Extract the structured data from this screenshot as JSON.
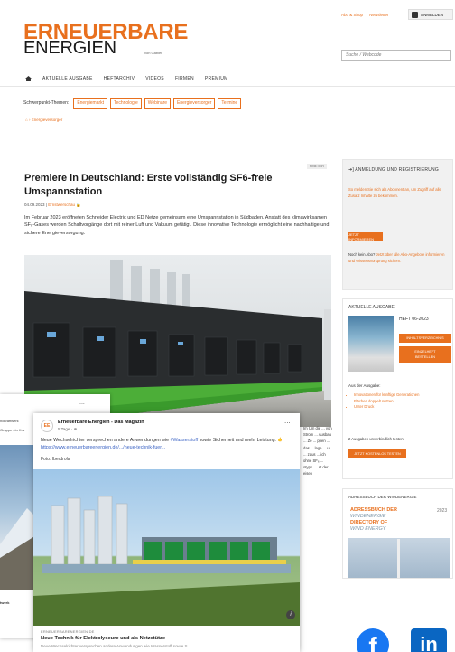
{
  "header": {
    "logo_top": "ERNEUERBARE",
    "logo_bottom": "ENERGIEN",
    "logo_tag": "von Gabler",
    "link_abo": "Abo & Shop",
    "link_newsletter": "Newsletter",
    "login_label": "ANMELDEN",
    "search_placeholder": "Suche / Webcode"
  },
  "nav": {
    "items": [
      "AKTUELLE AUSGABE",
      "HEFTARCHIV",
      "VIDEOS",
      "FIRMEN",
      "PREMIUM"
    ]
  },
  "topics": {
    "label": "Schwerpunkt-Themen:",
    "items": [
      "Energiemarkt",
      "Technologie",
      "Webinare",
      "Energieversorger",
      "Termine"
    ]
  },
  "breadcrumb": "Energieversorger",
  "article": {
    "category": "FINETIER",
    "title": "Premiere in Deutschland: Erste vollständig SF6-freie Umspannstation",
    "date": "04.09.2023",
    "source": "Ernstwerschau",
    "lead": "Im Februar 2023 eröffneten Schneider Electric und ED Netze gemeinsam eine Umspannstation in Südbaden. Anstatt des klimawirksamen SF₆-Gases werden Schaltvorgänge dort mit reiner Luft und Vakuum getätigt. Diese innovative Technologie ermöglicht eine nachhaltige und sichere Energieversorgung.",
    "photo_credit": "Schneider Electric",
    "right_text": "Im Um die ... von Strom ... Ausbau ... Ze ... ppen ... das ... lage ... ur ... zaus ... ich ohne SF₆ ... otyps. ... st der ... eisen"
  },
  "sidebar": {
    "login_title": "ANMELDUNG UND REGISTRIERUNG",
    "login_text": "So melden Sie sich als Abonnent an, um Zugriff auf alle Zusatz Inhalte zu bekommen.",
    "login_button": "JETZT INFORMIEREN",
    "no_abo_text_a": "Noch kein Abo?",
    "no_abo_text_b": "Jetzt über alle Abo-Angebote informieren und Wissensvorsprung sichern.",
    "issue_title": "AKTUELLE AUSGABE",
    "issue_name": "HEFT 06-2023",
    "btn_contents": "INHALTSVERZEICHNIS",
    "btn_order_1": "EINZELHEFT",
    "btn_order_2": "BESTELLEN",
    "from_issue": "Aus der Ausgabe:",
    "issue_items": [
      "Innovationen für künftige Generationen",
      "Flächen doppelt nutzen",
      "Unter Druck"
    ],
    "free_count": "2 Ausgaben unverbindlich testen:",
    "btn_trial": "JETZT KOSTENLOS TESTEN",
    "directory_title": "ADRESSBUCH DER WINDENERGIE",
    "directory_book_1": "ADRESSBUCH DER",
    "directory_book_2": "WINDENERGIE",
    "directory_book_3": "DIRECTORY OF",
    "directory_book_4": "WIND ENERGY",
    "directory_year": "2023"
  },
  "left_card": {
    "more": "...",
    "line1": "ndkraftwerk",
    "line2": "Gruppe ein Kra",
    "footer": "twerk"
  },
  "fb_embed": {
    "avatar": "EE",
    "page_name": "Erneuerbare Energien - Das Magazin",
    "time": "5 Tage · ",
    "more": "...",
    "text_a": "Neue Wechselrichter versprechen andere Anwendungen wie ",
    "hashtag": "#Wasserstoff",
    "text_b": " sowie Sicherheit und mehr Leistung: 👉 ",
    "link": "https://www.erneuerbareenergien.de/.../neue-technik-fuer...",
    "photo_credit": "Foto: Iberdrola",
    "caption_source": "ERNEUERBARENERGIEN.DE",
    "caption_title": "Neue Technik für Elektrolyseure und als Netzstütze",
    "caption_text": "Neue Wechselrichter versprechen andere Anwendungen wie Wasserstoff sowie S...",
    "info": "i"
  },
  "social": {
    "facebook": "f",
    "linkedin": "in"
  }
}
